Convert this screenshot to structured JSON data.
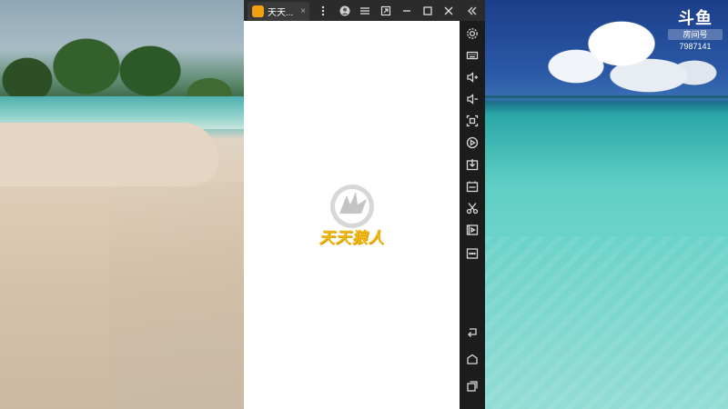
{
  "window": {
    "tab_title": "天天...",
    "tab_close": "×"
  },
  "splash": {
    "title": "天天狼人"
  },
  "watermark": {
    "logo": "斗鱼",
    "room_label": "房间号",
    "room_id": "7987141"
  },
  "toolbar": {
    "buttons": [
      "user-icon",
      "menu-icon",
      "restore-icon",
      "minimize-icon",
      "maximize-icon",
      "close-icon",
      "collapse-icon"
    ]
  },
  "sidebar": {
    "buttons": [
      "settings",
      "keyboard",
      "volume-up",
      "volume-down",
      "screenshot",
      "record",
      "install",
      "apk",
      "scissors",
      "video",
      "more",
      "back",
      "home",
      "recents"
    ]
  },
  "colors": {
    "accent": "#f1b814",
    "titlebar": "#2b2b2b",
    "sidebar": "#1c1c1c"
  }
}
